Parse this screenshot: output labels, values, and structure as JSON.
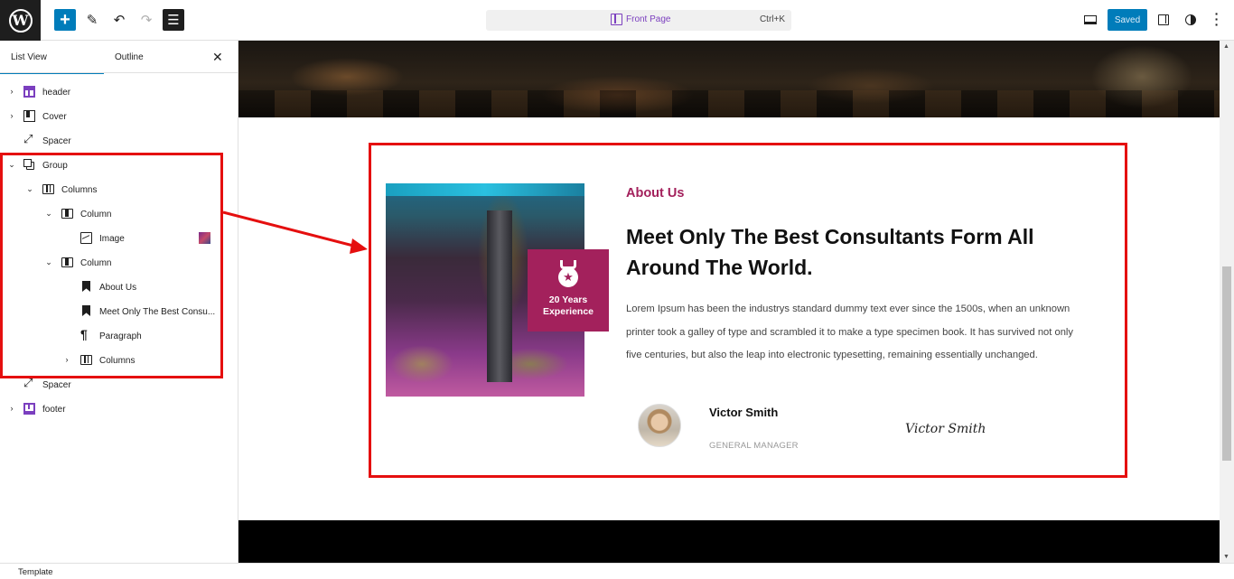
{
  "topbar": {
    "add_icon": "plus-icon",
    "edit_icon": "pencil-icon",
    "undo_icon": "undo-icon",
    "redo_icon": "redo-icon",
    "list_icon": "list-view-icon",
    "document_title": "Front Page",
    "shortcut": "Ctrl+K",
    "saved_label": "Saved"
  },
  "sidebar": {
    "tabs": {
      "list_view": "List View",
      "outline": "Outline"
    },
    "items": [
      {
        "label": "header",
        "icon": "template-part-icon"
      },
      {
        "label": "Cover",
        "icon": "cover-icon"
      },
      {
        "label": "Spacer",
        "icon": "spacer-icon"
      },
      {
        "label": "Group",
        "icon": "group-icon"
      },
      {
        "label": "Columns",
        "icon": "columns-icon"
      },
      {
        "label": "Column",
        "icon": "column-icon"
      },
      {
        "label": "Image",
        "icon": "image-icon"
      },
      {
        "label": "Column",
        "icon": "column-icon"
      },
      {
        "label": "About Us",
        "icon": "heading-icon"
      },
      {
        "label": "Meet Only The Best Consu...",
        "icon": "heading-icon"
      },
      {
        "label": "Paragraph",
        "icon": "paragraph-icon"
      },
      {
        "label": "Columns",
        "icon": "columns-icon"
      },
      {
        "label": "Spacer",
        "icon": "spacer-icon"
      },
      {
        "label": "footer",
        "icon": "template-part-icon"
      }
    ]
  },
  "footer_bar": {
    "label": "Template"
  },
  "canvas": {
    "badge": {
      "text": "20 Years\nExperience"
    },
    "about_label": "About Us",
    "heading": "Meet Only The Best Consultants Form All Around The World.",
    "paragraph": "Lorem Ipsum has been the industrys standard dummy text ever since the 1500s, when an unknown printer took a galley of type and scrambled it to make a type specimen book. It has survived not only five centuries, but also the leap into electronic typesetting, remaining essentially unchanged.",
    "person_name": "Victor Smith",
    "person_role": "GENERAL MANAGER",
    "signature": "Victor Smith"
  },
  "colors": {
    "accent": "#007cba",
    "brand": "#a3215c",
    "highlight": "#e50f0f",
    "template_part": "#7b3fbf"
  }
}
